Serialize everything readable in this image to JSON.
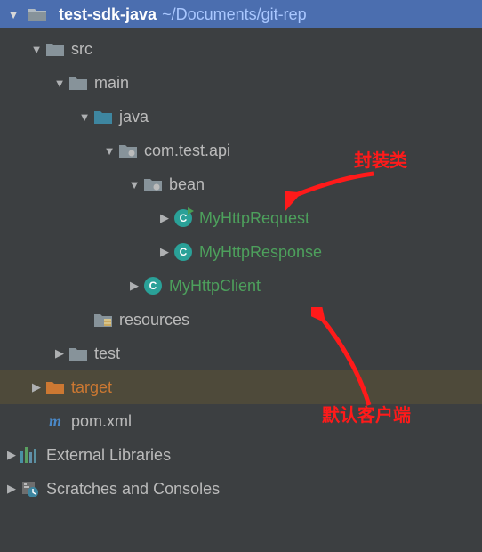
{
  "header": {
    "project_name": "test-sdk-java",
    "project_path": "~/Documents/git-rep"
  },
  "tree": {
    "src": "src",
    "main": "main",
    "java": "java",
    "pkg_api": "com.test.api",
    "bean": "bean",
    "MyHttpRequest": "MyHttpRequest",
    "MyHttpResponse": "MyHttpResponse",
    "MyHttpClient": "MyHttpClient",
    "resources": "resources",
    "test": "test",
    "target": "target",
    "pom": "pom.xml",
    "ext_lib": "External Libraries",
    "scratches": "Scratches and Consoles"
  },
  "annotations": {
    "wrapper_class": "封装类",
    "default_client": "默认客户端"
  },
  "icons": {
    "class_letter": "C",
    "maven_letter": "m"
  },
  "colors": {
    "header_bg": "#4b6eaf",
    "text": "#bbbbbb",
    "class_text": "#4da05c",
    "target_text": "#cc7832",
    "annotation": "#ff1a1a"
  }
}
